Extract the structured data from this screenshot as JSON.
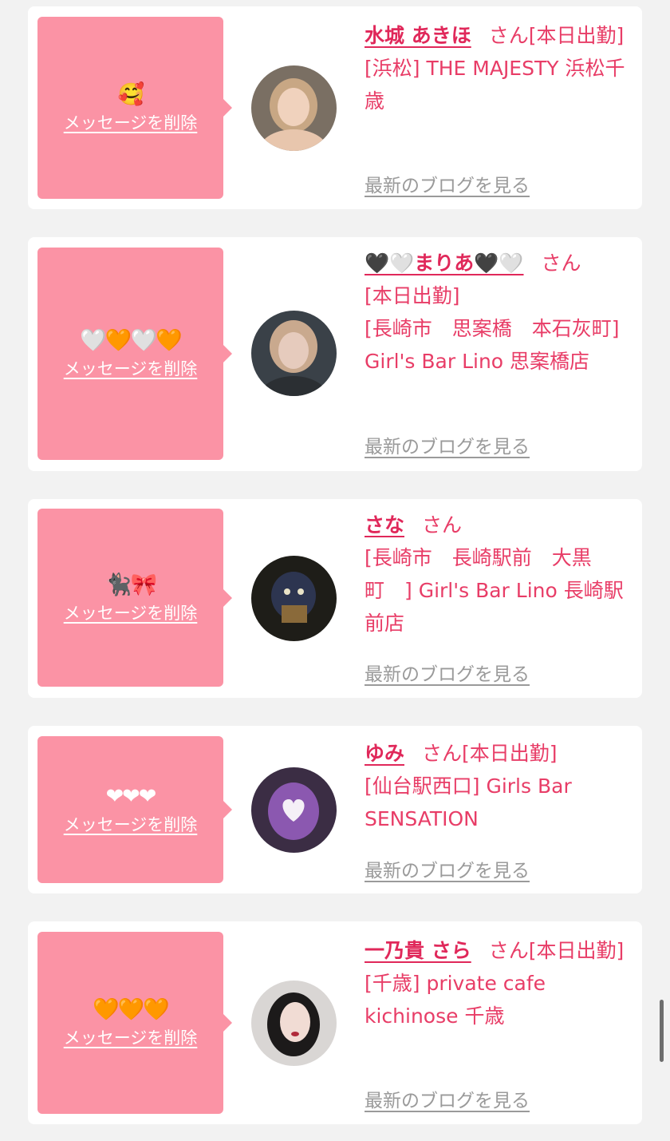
{
  "common": {
    "delete_label": "メッセージを削除",
    "blog_label": "最新のブログを見る",
    "san_label": "さん"
  },
  "cards": [
    {
      "emoji": "🥰",
      "name": "水城 あきほ",
      "status": "[本日出勤]",
      "shop": "[浜松] THE MAJESTY 浜松千歳"
    },
    {
      "emoji": "🤍🧡🤍🧡",
      "name": "🖤🤍まりあ🖤🤍",
      "status": "[本日出勤]",
      "shop": "[長崎市　思案橋　本石灰町] Girl's Bar Lino 思案橋店"
    },
    {
      "emoji": "🐈‍⬛🎀",
      "name": "さな",
      "status": "",
      "shop": "[長崎市　長崎駅前　大黒町　] Girl's Bar Lino 長崎駅前店"
    },
    {
      "emoji": "❤❤❤",
      "name": "ゆみ",
      "status": "[本日出勤]",
      "shop": "[仙台駅西口] Girls Bar SENSATION"
    },
    {
      "emoji": "🧡🧡🧡",
      "name": "一乃貴 さら",
      "status": "[本日出勤]",
      "shop": "[千歳] private cafe kichinose 千歳"
    }
  ],
  "colors": {
    "page_bg": "#f2f2f2",
    "bubble": "#fb93a5",
    "name": "#e0285a",
    "text": "#e83d67",
    "blog_link": "#9a9a9a"
  }
}
